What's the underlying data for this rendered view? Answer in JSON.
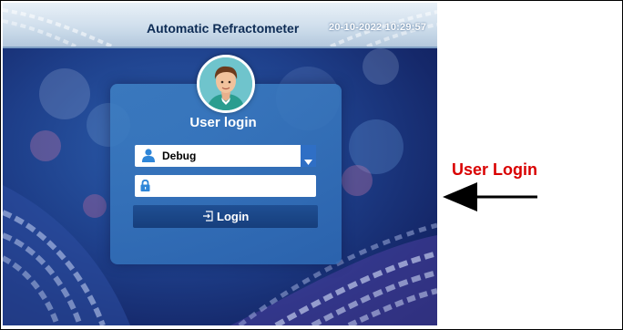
{
  "header": {
    "title": "Automatic Refractometer",
    "datetime": "20-10-2022 10:29:57"
  },
  "login": {
    "title": "User login",
    "username": "Debug",
    "password": "",
    "button_label": "Login"
  },
  "annotation": {
    "label": "User Login",
    "color": "#d90000"
  },
  "icons": {
    "user": "user-icon",
    "lock": "lock-icon",
    "dropdown": "chevron-down-icon",
    "login": "login-icon",
    "arrow": "arrow-left-icon"
  },
  "colors": {
    "header": "#cfdeec",
    "panel": "#3e80c4",
    "button": "#1f4f93",
    "accent_icon": "#2f86d8"
  }
}
